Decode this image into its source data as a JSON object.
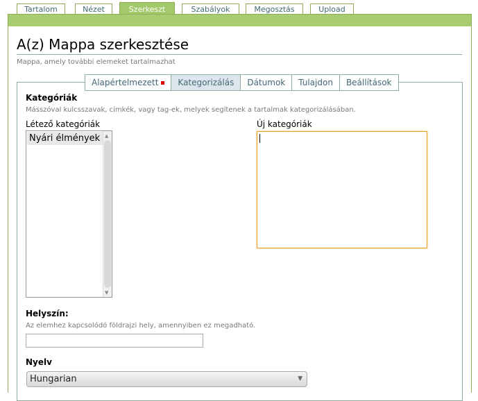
{
  "top_tabs": [
    {
      "label": "Tartalom"
    },
    {
      "label": "Nézet"
    },
    {
      "label": "Szerkeszt"
    },
    {
      "label": "Szabályok"
    },
    {
      "label": "Megosztás"
    },
    {
      "label": "Upload"
    }
  ],
  "selected_top_tab": "Szerkeszt",
  "page": {
    "title": "A(z) Mappa szerkesztése",
    "description": "Mappa, amely további elemeket tartalmazhat"
  },
  "sub_tabs": [
    {
      "label": "Alapértelmezett"
    },
    {
      "label": "Kategorizálás"
    },
    {
      "label": "Dátumok"
    },
    {
      "label": "Tulajdon"
    },
    {
      "label": "Beállítások"
    }
  ],
  "selected_sub_tab": "Kategorizálás",
  "categories": {
    "label": "Kategóriák",
    "help": "Másszóval kulcsszavak, címkék, vagy tag-ek, melyek segítenek a tartalmak kategorizálásában.",
    "existing_label": "Létező kategóriák",
    "existing_items": [
      "Nyári élmények"
    ],
    "new_label": "Új kategóriák",
    "new_value": ""
  },
  "location": {
    "label": "Helyszín:",
    "help": "Az elemhez kapcsolódó földrajzi hely, amennyiben ez megadható.",
    "value": ""
  },
  "language": {
    "label": "Nyelv",
    "selected": "Hungarian"
  },
  "colors": {
    "accent_green": "#a8cd70",
    "link_blue": "#436976",
    "required_red": "#e00000",
    "focus_orange": "#f0a020"
  }
}
